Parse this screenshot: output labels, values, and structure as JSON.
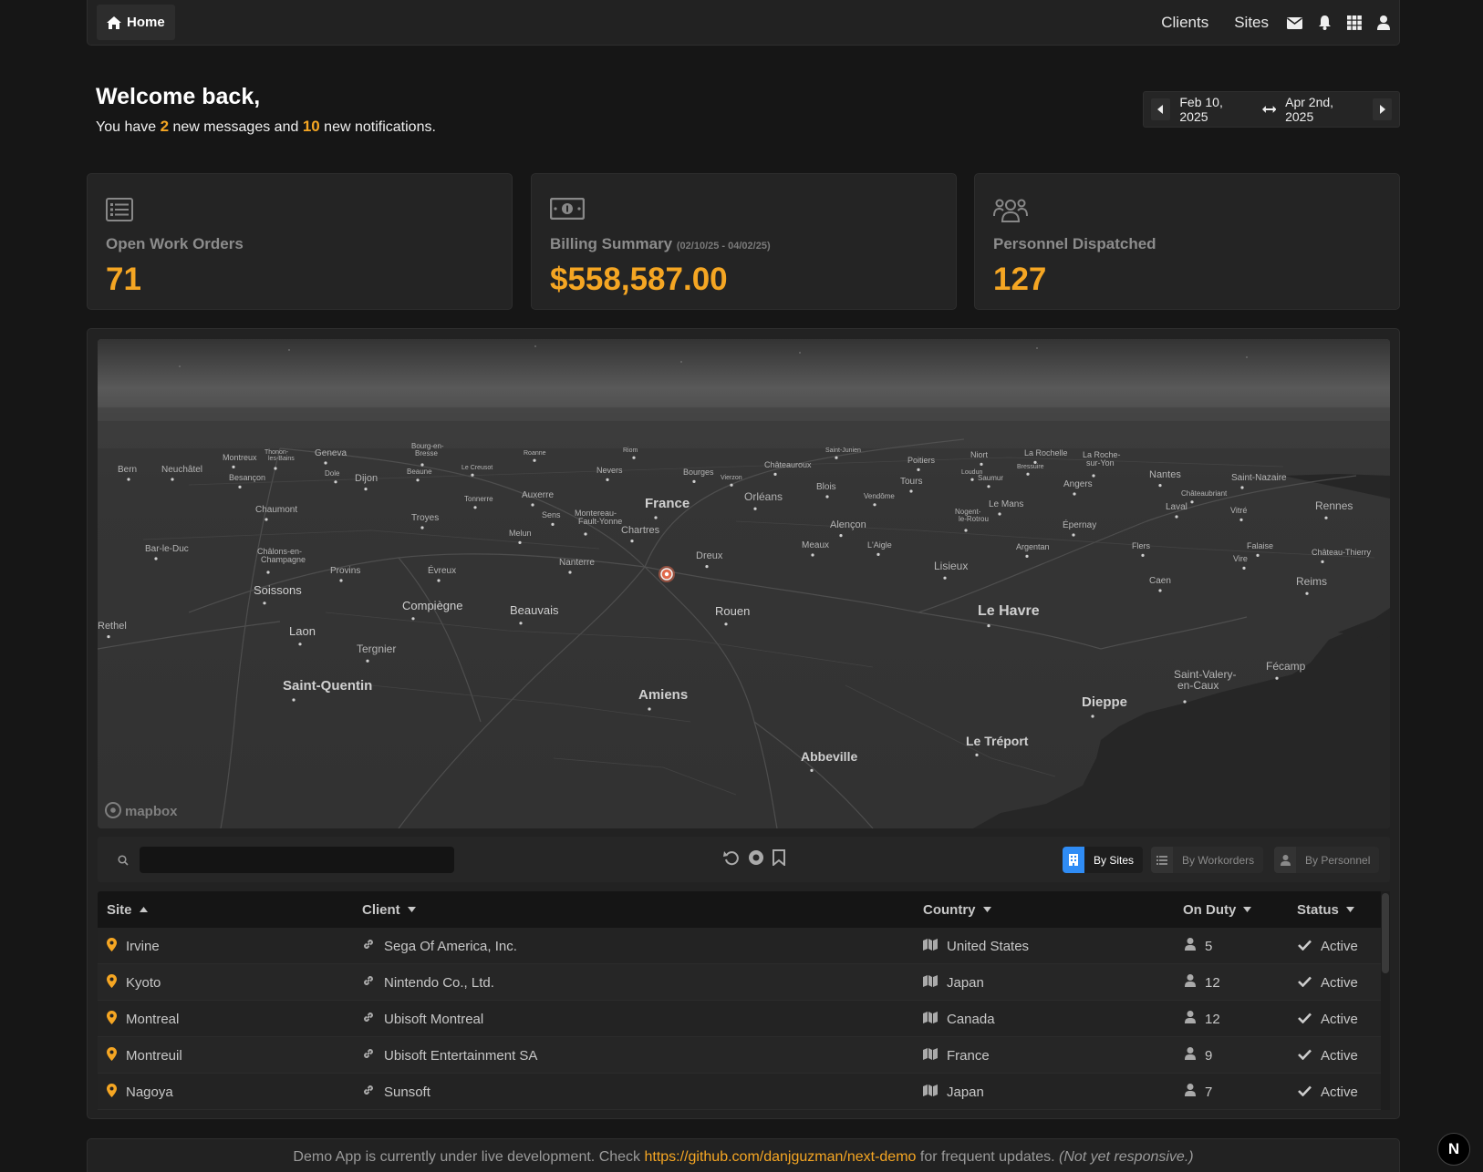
{
  "nav": {
    "home_label": "Home",
    "links": [
      "Clients",
      "Sites"
    ],
    "icons": [
      "envelope-icon",
      "bell-icon",
      "grid-icon",
      "user-icon"
    ]
  },
  "welcome": {
    "title": "Welcome back,",
    "sub_1": "You have ",
    "messages": "2",
    "sub_2": " new messages and ",
    "notifications": "10",
    "sub_3": " new notifications."
  },
  "date_range": {
    "start": "Feb 10, 2025",
    "end": "Apr 2nd, 2025"
  },
  "cards": [
    {
      "icon": "list-icon",
      "label": "Open Work Orders",
      "note": "",
      "value": "71"
    },
    {
      "icon": "money-bill-icon",
      "label": "Billing Summary",
      "note": "(02/10/25 - 04/02/25)",
      "value": "$558,587.00"
    },
    {
      "icon": "users-icon",
      "label": "Personnel Dispatched",
      "note": "",
      "value": "127"
    }
  ],
  "map": {
    "attribution": "mapbox",
    "cities": [
      {
        "name": "Bern"
      },
      {
        "name": "Neuchâtel"
      },
      {
        "name": "Montreux"
      },
      {
        "name": "Thonon-les-Bains"
      },
      {
        "name": "Geneva"
      },
      {
        "name": "Bourg-en-Bresse"
      },
      {
        "name": "Roanne"
      },
      {
        "name": "Riom"
      },
      {
        "name": "Saint-Junien"
      },
      {
        "name": "Niort"
      },
      {
        "name": "La Rochelle"
      },
      {
        "name": "La Roche-sur-Yon"
      },
      {
        "name": "Besançon"
      },
      {
        "name": "Dole"
      },
      {
        "name": "Dijon"
      },
      {
        "name": "Beaune"
      },
      {
        "name": "Le Creusot"
      },
      {
        "name": "Nevers"
      },
      {
        "name": "Bourges"
      },
      {
        "name": "Vierzon"
      },
      {
        "name": "Châteauroux"
      },
      {
        "name": "Poitiers"
      },
      {
        "name": "Loudun"
      },
      {
        "name": "Bressuire"
      },
      {
        "name": "Saumur"
      },
      {
        "name": "Nantes"
      },
      {
        "name": "Saint-Nazaire"
      },
      {
        "name": "Chaumont"
      },
      {
        "name": "Tonnerre"
      },
      {
        "name": "Auxerre"
      },
      {
        "name": "France"
      },
      {
        "name": "Orléans"
      },
      {
        "name": "Blois"
      },
      {
        "name": "Vendôme"
      },
      {
        "name": "Tours"
      },
      {
        "name": "Angers"
      },
      {
        "name": "Châteaubriant"
      },
      {
        "name": "Rennes"
      },
      {
        "name": "Troyes"
      },
      {
        "name": "Sens"
      },
      {
        "name": "Montereau-Fault-Yonne"
      },
      {
        "name": "Nogent-le-Rotrou"
      },
      {
        "name": "Le Mans"
      },
      {
        "name": "Laval"
      },
      {
        "name": "Vitré"
      },
      {
        "name": "Bar-le-Duc"
      },
      {
        "name": "Châlons-en-Champagne"
      },
      {
        "name": "Provins"
      },
      {
        "name": "Melun"
      },
      {
        "name": "Chartres"
      },
      {
        "name": "Alençon"
      },
      {
        "name": "Épernay"
      },
      {
        "name": "Meaux"
      },
      {
        "name": "Nanterre"
      },
      {
        "name": "Dreux"
      },
      {
        "name": "L'Aigle"
      },
      {
        "name": "Argentan"
      },
      {
        "name": "Flers"
      },
      {
        "name": "Falaise"
      },
      {
        "name": "Vire"
      },
      {
        "name": "Château-Thierry"
      },
      {
        "name": "Évreux"
      },
      {
        "name": "Lisieux"
      },
      {
        "name": "Caen"
      },
      {
        "name": "Reims"
      },
      {
        "name": "Soissons"
      },
      {
        "name": "Compiègne"
      },
      {
        "name": "Beauvais"
      },
      {
        "name": "Rouen"
      },
      {
        "name": "Le Havre"
      },
      {
        "name": "Rethel"
      },
      {
        "name": "Laon"
      },
      {
        "name": "Tergnier"
      },
      {
        "name": "Fécamp"
      },
      {
        "name": "Saint-Valery-en-Caux"
      },
      {
        "name": "Saint-Quentin"
      },
      {
        "name": "Amiens"
      },
      {
        "name": "Dieppe"
      },
      {
        "name": "Le Tréport"
      },
      {
        "name": "Abbeville"
      }
    ]
  },
  "toolbar": {
    "search_placeholder": "",
    "icons": [
      "undo-icon",
      "record-icon",
      "bookmark-icon"
    ],
    "tabs": [
      {
        "label": "By Sites",
        "active": true
      },
      {
        "label": "By Workorders",
        "active": false
      },
      {
        "label": "By Personnel",
        "active": false
      }
    ]
  },
  "table": {
    "columns": [
      "Site",
      "Client",
      "Country",
      "On Duty",
      "Status"
    ],
    "rows": [
      {
        "site": "Irvine",
        "client": "Sega Of America, Inc.",
        "country": "United States",
        "on_duty": "5",
        "status": "Active"
      },
      {
        "site": "Kyoto",
        "client": "Nintendo Co., Ltd.",
        "country": "Japan",
        "on_duty": "12",
        "status": "Active"
      },
      {
        "site": "Montreal",
        "client": "Ubisoft Montreal",
        "country": "Canada",
        "on_duty": "12",
        "status": "Active"
      },
      {
        "site": "Montreuil",
        "client": "Ubisoft Entertainment SA",
        "country": "France",
        "on_duty": "9",
        "status": "Active"
      },
      {
        "site": "Nagoya",
        "client": "Sunsoft",
        "country": "Japan",
        "on_duty": "7",
        "status": "Active"
      }
    ]
  },
  "footer": {
    "text_1": "Demo App is currently under live development. Check ",
    "link": "https://github.com/danjguzman/next-demo",
    "text_2": " for frequent updates. ",
    "note": "(Not yet responsive.)"
  },
  "badge": "N",
  "colors": {
    "accent": "#f5a623",
    "active_tab": "#2f8cf5",
    "background": "#161616"
  }
}
